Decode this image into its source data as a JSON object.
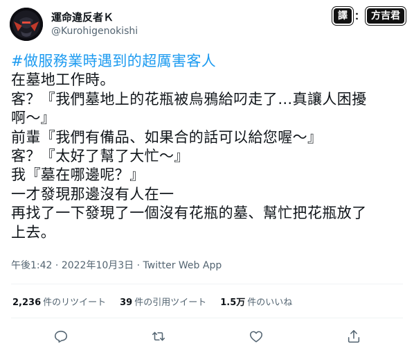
{
  "author": {
    "display_name": "運命違反者Ｋ",
    "handle": "@Kurohigenokishi"
  },
  "translator_tag": {
    "prefix": "譯",
    "separator": "：",
    "name": "方吉君"
  },
  "tweet": {
    "hashtag": "#做服務業時遇到的超厲害客人",
    "lines": [
      "在墓地工作時。",
      "客？『我們墓地上的花瓶被烏鴉給叼走了…真讓人困擾",
      "啊～』",
      "前輩『我們有備品、如果合的話可以給您喔～』",
      "客？『太好了幫了大忙～』",
      "我『墓在哪邊呢？』",
      "一才發現那邊沒有人在一",
      "再找了一下發現了一個沒有花瓶的墓、幫忙把花瓶放了",
      "上去。"
    ],
    "time": "午後1:42",
    "date": "2022年10月3日",
    "source": "Twitter Web App",
    "meta_separator": " · "
  },
  "stats": {
    "retweets_count": "2,236",
    "retweets_label": "件のリツイート",
    "quotes_count": "39",
    "quotes_label": "件の引用ツイート",
    "likes_count": "1.5万",
    "likes_label": "件のいいね"
  },
  "actions": {
    "icons": [
      "reply-icon",
      "retweet-icon",
      "like-icon",
      "share-icon"
    ]
  },
  "colors": {
    "hashtag": "#1d9bf0",
    "text": "#0f1419",
    "secondary": "#536471",
    "divider": "#eff3f4"
  }
}
